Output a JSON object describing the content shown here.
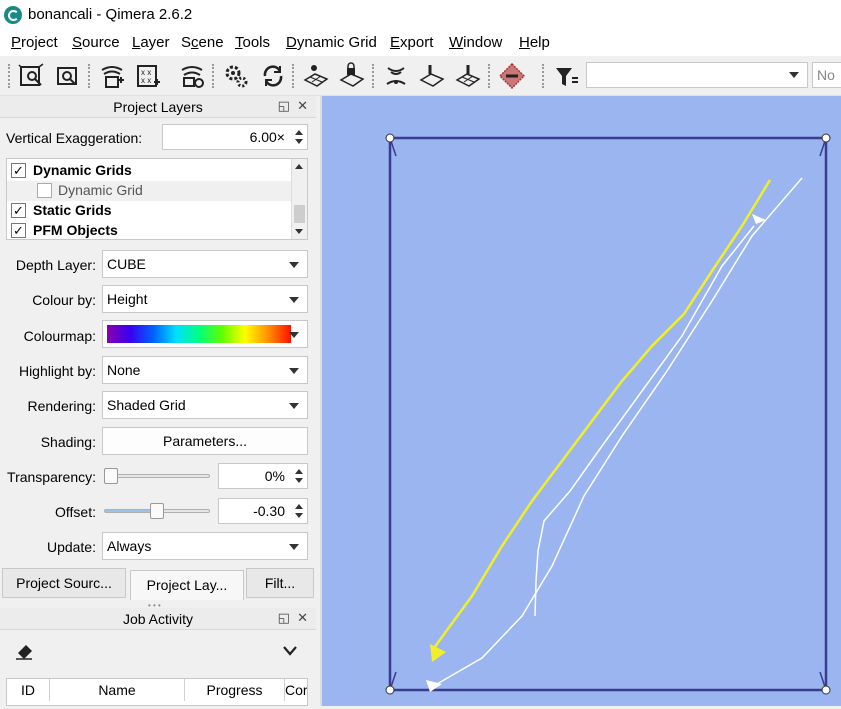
{
  "window": {
    "title": "bonancali - Qimera 2.6.2"
  },
  "menubar": {
    "items": [
      {
        "label": "Project",
        "u": "P",
        "rest": "roject"
      },
      {
        "label": "Source",
        "u": "S",
        "rest": "ource"
      },
      {
        "label": "Layer",
        "u": "L",
        "rest": "ayer"
      },
      {
        "label": "Scene",
        "pre": "S",
        "u": "c",
        "rest": "ene"
      },
      {
        "label": "Tools",
        "u": "T",
        "rest": "ools"
      },
      {
        "label": "Dynamic Grid",
        "u": "D",
        "rest": "ynamic Grid"
      },
      {
        "label": "Export",
        "u": "E",
        "rest": "xport"
      },
      {
        "label": "Window",
        "u": "W",
        "rest": "indow"
      },
      {
        "label": "Help",
        "u": "H",
        "rest": "elp"
      }
    ]
  },
  "toolbar": {
    "combo_value": "",
    "next_combo_text": "No"
  },
  "project_layers": {
    "title": "Project Layers",
    "vertical_exaggeration_label": "Vertical Exaggeration:",
    "vertical_exaggeration_value": "6.00×",
    "tree": [
      {
        "label": "Dynamic Grids",
        "checked": true,
        "bold": true
      },
      {
        "label": "Dynamic Grid",
        "checked": false,
        "bold": false
      },
      {
        "label": "Static Grids",
        "checked": true,
        "bold": true
      },
      {
        "label": "PFM Objects",
        "checked": true,
        "bold": true
      }
    ],
    "depth_layer_label": "Depth Layer:",
    "depth_layer_value": "CUBE",
    "colour_by_label": "Colour by:",
    "colour_by_value": "Height",
    "colourmap_label": "Colourmap:",
    "highlight_by_label": "Highlight by:",
    "highlight_by_value": "None",
    "rendering_label": "Rendering:",
    "rendering_value": "Shaded Grid",
    "shading_label": "Shading:",
    "shading_button": "Parameters...",
    "transparency_label": "Transparency:",
    "transparency_value": "0%",
    "transparency_level": 0,
    "offset_label": "Offset:",
    "offset_value": "-0.30",
    "offset_level": 0.5,
    "update_label": "Update:",
    "update_value": "Always"
  },
  "tabs": [
    {
      "label": "Project Sourc...",
      "active": false
    },
    {
      "label": "Project Lay...",
      "active": true
    },
    {
      "label": "Filt...",
      "active": false
    }
  ],
  "job_activity": {
    "title": "Job Activity",
    "columns": [
      "ID",
      "Name",
      "Progress",
      "Cor"
    ]
  },
  "colors": {
    "viewport_bg": "#9ab5f0",
    "bounds": "#3a3a90",
    "track_yellow": "#f2ef2a",
    "track_white": "#ffffff"
  }
}
